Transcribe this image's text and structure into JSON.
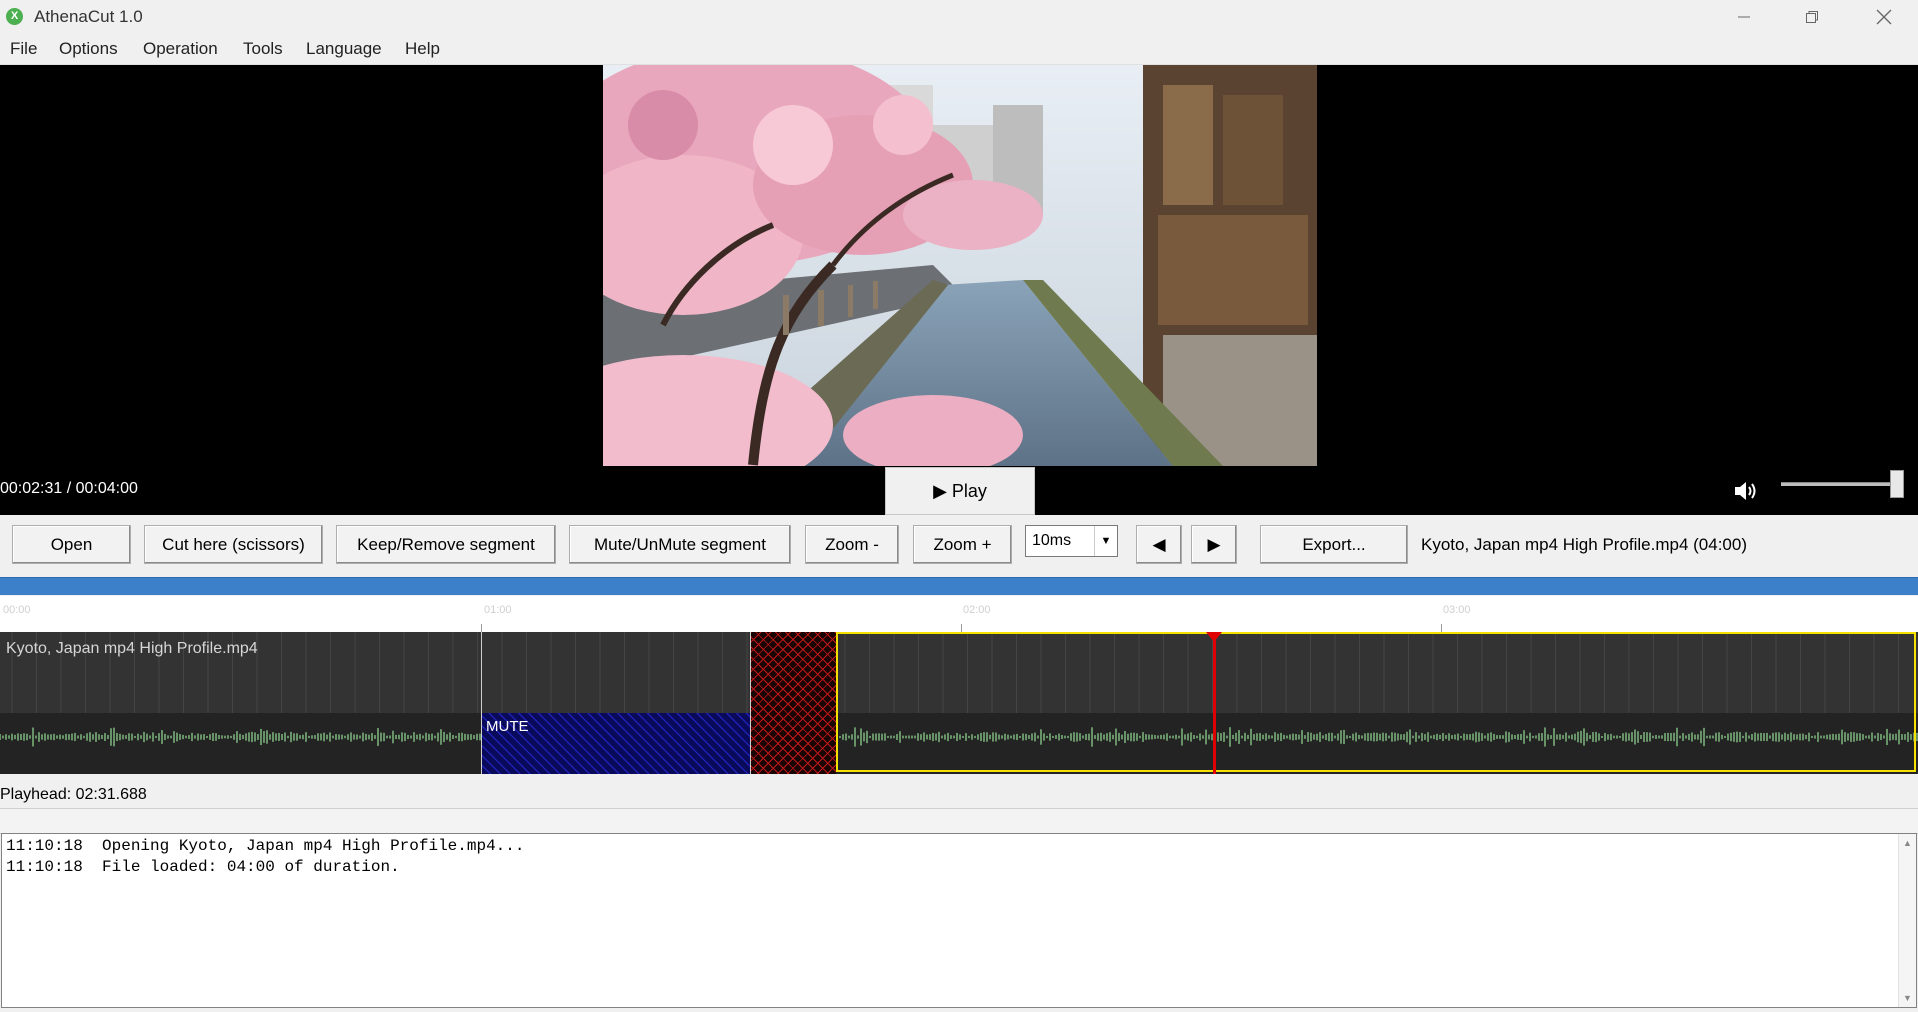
{
  "window": {
    "title": "AthenaCut 1.0",
    "app_icon_glyph": "X",
    "controls": [
      "minimize-icon",
      "restore-icon",
      "close-icon"
    ]
  },
  "menu": [
    {
      "label": "File"
    },
    {
      "label": "Options"
    },
    {
      "label": "Operation"
    },
    {
      "label": "Tools"
    },
    {
      "label": "Language"
    },
    {
      "label": "Help"
    }
  ],
  "player": {
    "timecode": "00:02:31 / 00:04:00",
    "play_label": "▶ Play",
    "volume_icon": "speaker-icon",
    "volume_level": 1.0
  },
  "toolbar": {
    "open": "Open",
    "cut": "Cut here (scissors)",
    "keep_remove": "Keep/Remove segment",
    "mute_unmute": "Mute/UnMute segment",
    "zoom_out": "Zoom -",
    "zoom_in": "Zoom +",
    "step_value": "10ms",
    "prev_icon": "triangle-left-icon",
    "next_icon": "triangle-right-icon",
    "export": "Export...",
    "file_info": "Kyoto, Japan mp4 High Profile.mp4  (04:00)"
  },
  "ruler": {
    "labels": [
      "00:00",
      "01:00",
      "02:00",
      "03:00"
    ]
  },
  "timeline": {
    "clip_name": "Kyoto, Japan mp4 High Profile.mp4",
    "mute_label": "MUTE",
    "colors": {
      "selected_border": "#f5e000",
      "playhead": "#e00000",
      "removed": "#c01818",
      "mute": "#2828d8",
      "waveform": "#7fb77f"
    }
  },
  "status": {
    "playhead": "Playhead: 02:31.688"
  },
  "log": {
    "lines": [
      "11:10:18  Opening Kyoto, Japan mp4 High Profile.mp4...",
      "11:10:18  File loaded: 04:00 of duration."
    ]
  }
}
